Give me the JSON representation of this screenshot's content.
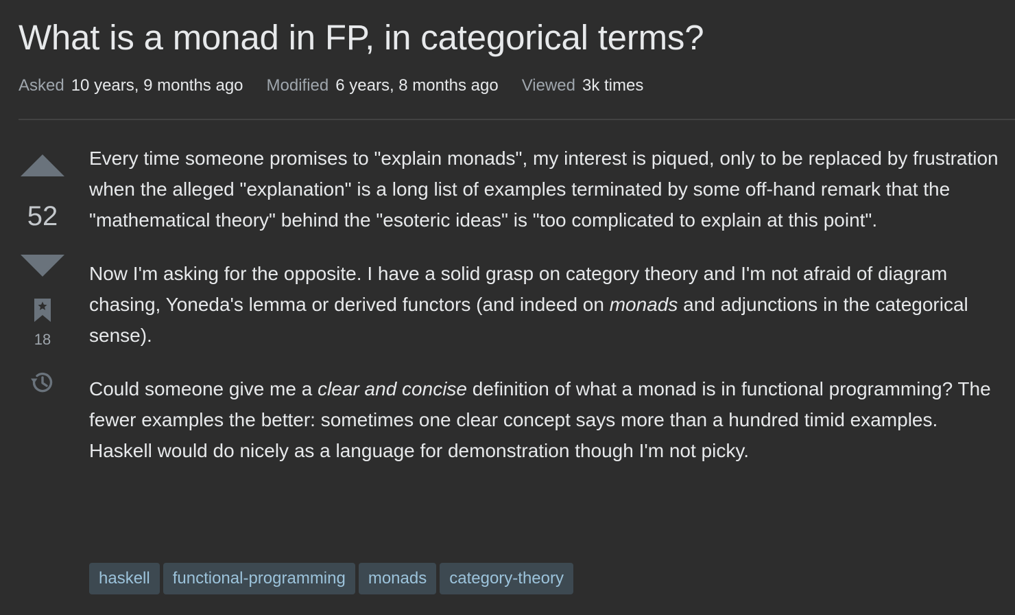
{
  "question": {
    "title": "What is a monad in FP, in categorical terms?"
  },
  "meta": {
    "asked_label": "Asked",
    "asked_value": "10 years, 9 months ago",
    "modified_label": "Modified",
    "modified_value": "6 years, 8 months ago",
    "viewed_label": "Viewed",
    "viewed_value": "3k times"
  },
  "vote": {
    "score": "52",
    "bookmark_count": "18",
    "icons": [
      "upvote-arrow-icon",
      "downvote-arrow-icon",
      "bookmark-icon",
      "history-icon"
    ]
  },
  "body": {
    "p1": "Every time someone promises to \"explain monads\", my interest is piqued, only to be replaced by frustration when the alleged \"explanation\" is a long list of examples terminated by some off-hand remark that the \"mathematical theory\" behind the \"esoteric ideas\" is \"too complicated to explain at this point\".",
    "p2_a": "Now I'm asking for the opposite. I have a solid grasp on category theory and I'm not afraid of diagram chasing, Yoneda's lemma or derived functors (and indeed on ",
    "p2_em": "monads",
    "p2_b": " and adjunctions in the categorical sense).",
    "p3_a": "Could someone give me a ",
    "p3_em": "clear and concise",
    "p3_b": " definition of what a monad is in functional programming? The fewer examples the better: sometimes one clear concept says more than a hundred timid examples. Haskell would do nicely as a language for demonstration though I'm not picky."
  },
  "tags": [
    "haskell",
    "functional-programming",
    "monads",
    "category-theory"
  ],
  "colors": {
    "background": "#2d2d2d",
    "text": "#e7e9eb",
    "muted": "#9fa6ad",
    "vote_arrow": "#6a737c",
    "tag_bg": "#3d4951",
    "tag_text": "#9cc3db"
  }
}
